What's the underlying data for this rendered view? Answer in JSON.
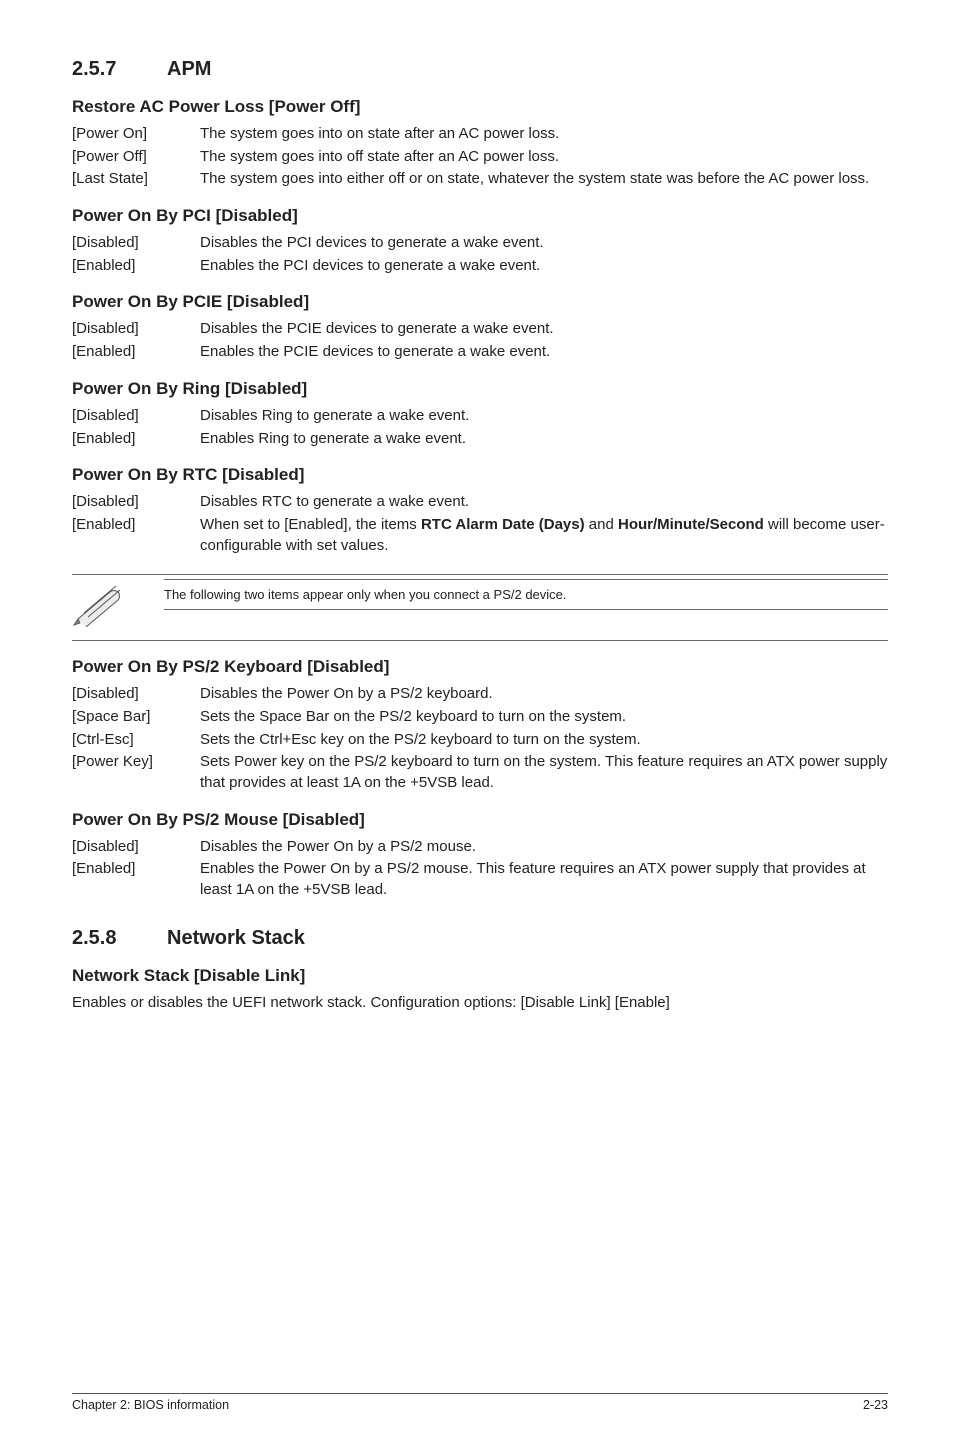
{
  "s257": {
    "num": "2.5.7",
    "title": "APM",
    "settings": [
      {
        "heading": "Restore AC Power Loss [Power Off]",
        "options": [
          {
            "key": "[Power On]",
            "desc": "The system goes into on state after an AC power loss."
          },
          {
            "key": "[Power Off]",
            "desc": "The system goes into off state after an AC power loss."
          },
          {
            "key": "[Last State]",
            "desc": "The system goes into either off or on state, whatever the system state was before the AC power loss."
          }
        ]
      },
      {
        "heading": "Power On By PCI [Disabled]",
        "options": [
          {
            "key": "[Disabled]",
            "desc": "Disables the PCI devices to generate a wake event."
          },
          {
            "key": "[Enabled]",
            "desc": "Enables the PCI devices to generate a wake event."
          }
        ]
      },
      {
        "heading": "Power On By PCIE [Disabled]",
        "options": [
          {
            "key": "[Disabled]",
            "desc": "Disables the PCIE devices to generate a wake event."
          },
          {
            "key": "[Enabled]",
            "desc": "Enables the PCIE devices to generate a wake event."
          }
        ]
      },
      {
        "heading": "Power On By Ring [Disabled]",
        "options": [
          {
            "key": "[Disabled]",
            "desc": "Disables Ring to generate a wake event."
          },
          {
            "key": "[Enabled]",
            "desc": "Enables Ring to generate a wake event."
          }
        ]
      },
      {
        "heading": "Power On By RTC [Disabled]",
        "options": [
          {
            "key": "[Disabled]",
            "desc": "Disables RTC to generate a wake event."
          },
          {
            "key": "[Enabled]",
            "desc_html": "When set to [Enabled], the items <span class=\"bold\">RTC Alarm Date (Days)</span> and <span class=\"bold\">Hour/Minute/Second</span> will become user-configurable with set values."
          }
        ]
      }
    ],
    "note": "The following two items appear only when you connect a PS/2 device.",
    "settings2": [
      {
        "heading": "Power On By PS/2 Keyboard [Disabled]",
        "options": [
          {
            "key": "[Disabled]",
            "desc": "Disables the Power On by a PS/2 keyboard."
          },
          {
            "key": "[Space Bar]",
            "desc": "Sets the Space Bar on the PS/2 keyboard to turn on the system."
          },
          {
            "key": "[Ctrl-Esc]",
            "desc": "Sets the Ctrl+Esc key on the PS/2 keyboard to turn on the system."
          },
          {
            "key": "[Power Key]",
            "desc": "Sets Power key on the PS/2 keyboard to turn on the system. This feature requires an ATX power supply that provides at least 1A on the +5VSB lead."
          }
        ]
      },
      {
        "heading": "Power On By PS/2 Mouse [Disabled]",
        "options": [
          {
            "key": "[Disabled]",
            "desc": "Disables the Power On by a PS/2 mouse."
          },
          {
            "key": "[Enabled]",
            "desc": "Enables the Power On by a PS/2 mouse. This feature requires an ATX power supply that provides at least 1A on the +5VSB lead."
          }
        ]
      }
    ]
  },
  "s258": {
    "num": "2.5.8",
    "title": "Network Stack",
    "setting_heading": "Network Stack [Disable Link]",
    "setting_desc": "Enables or disables the UEFI network stack. Configuration options: [Disable Link] [Enable]"
  },
  "footer": {
    "left": "Chapter 2: BIOS information",
    "right": "2-23"
  }
}
